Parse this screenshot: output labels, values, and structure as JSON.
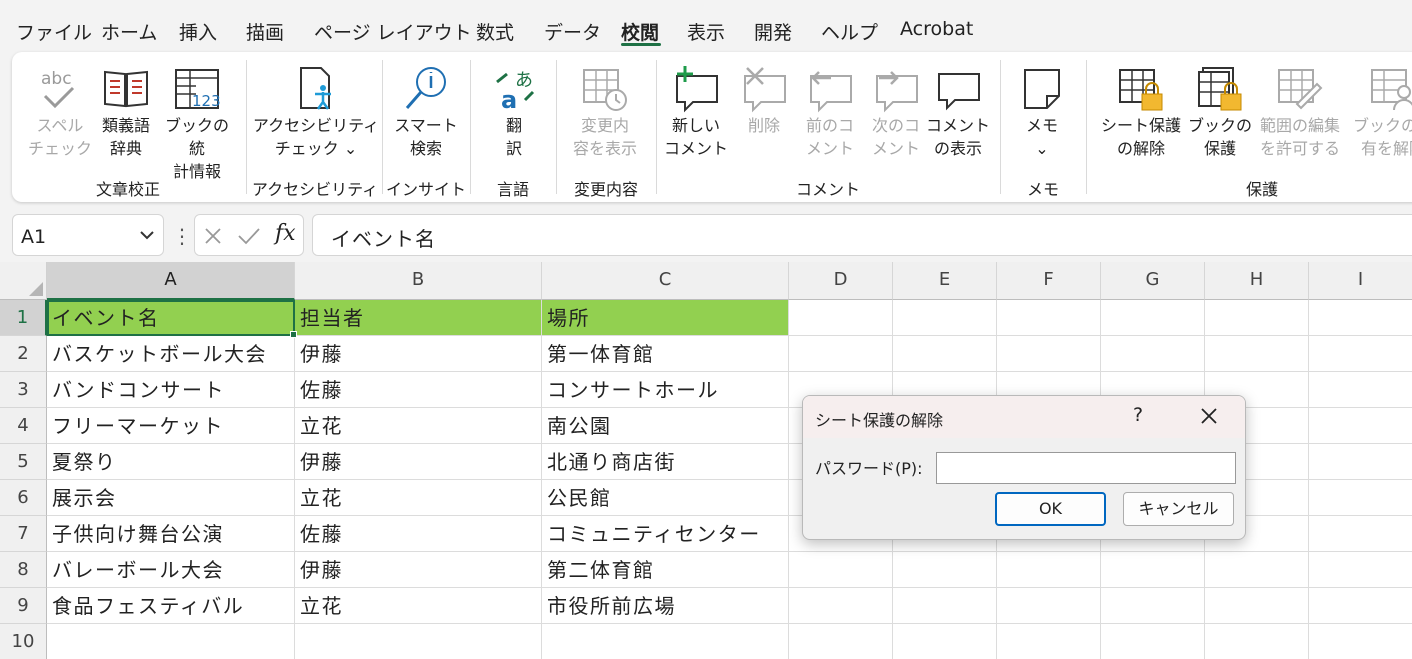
{
  "tabs": [
    {
      "label": "ファイル"
    },
    {
      "label": "ホーム"
    },
    {
      "label": "挿入"
    },
    {
      "label": "描画"
    },
    {
      "label": "ページ レイアウト"
    },
    {
      "label": "数式"
    },
    {
      "label": "データ"
    },
    {
      "label": "校閲"
    },
    {
      "label": "表示"
    },
    {
      "label": "開発"
    },
    {
      "label": "ヘルプ"
    },
    {
      "label": "Acrobat"
    }
  ],
  "active_tab": "校閲",
  "ribbon": {
    "buttons": {
      "spell": "スペル\nチェック",
      "thesaurus": "類義語\n辞典",
      "workbook_stats": "ブックの統\n計情報",
      "accessibility": "アクセシビリティ\nチェック ⌄",
      "smart_lookup": "スマート\n検索",
      "translate": "翻\n訳",
      "show_changes": "変更内\n容を表示",
      "new_comment": "新しい\nコメント",
      "delete": "削除",
      "prev_comment": "前のコ\nメント",
      "next_comment": "次のコ\nメント",
      "show_comments": "コメント\nの表示",
      "notes": "メモ\n⌄",
      "unprotect_sheet": "シート保護\nの解除",
      "protect_workbook": "ブックの\n保護",
      "allow_edit_ranges": "範囲の編集\nを許可する",
      "unshare": "ブックの共\n有を解除"
    },
    "groups": {
      "proofing": "文章校正",
      "accessibility": "アクセシビリティ",
      "insights": "インサイト",
      "language": "言語",
      "changes": "変更内容",
      "comments": "コメント",
      "notes": "メモ",
      "protect": "保護"
    }
  },
  "formula_bar": {
    "name_box": "A1",
    "fx": "fx",
    "content": "イベント名"
  },
  "grid": {
    "columns": [
      "A",
      "B",
      "C",
      "D",
      "E",
      "F",
      "G",
      "H",
      "I"
    ],
    "row_numbers": [
      "1",
      "2",
      "3",
      "4",
      "5",
      "6",
      "7",
      "8",
      "9",
      "10"
    ],
    "rows": [
      [
        "イベント名",
        "担当者",
        "場所"
      ],
      [
        "バスケットボール大会",
        "伊藤",
        "第一体育館"
      ],
      [
        "バンドコンサート",
        "佐藤",
        "コンサートホール"
      ],
      [
        "フリーマーケット",
        "立花",
        "南公園"
      ],
      [
        "夏祭り",
        "伊藤",
        "北通り商店街"
      ],
      [
        "展示会",
        "立花",
        "公民館"
      ],
      [
        "子供向け舞台公演",
        "佐藤",
        "コミュニティセンター"
      ],
      [
        "バレーボール大会",
        "伊藤",
        "第二体育館"
      ],
      [
        "食品フェスティバル",
        "立花",
        "市役所前広場"
      ],
      [
        "",
        "",
        ""
      ]
    ],
    "header_fill": "#92d050",
    "accent": "#1e7145"
  },
  "dialog": {
    "title": "シート保護の解除",
    "help": "?",
    "password_label": "パスワード(P):",
    "password_value": "",
    "ok": "OK",
    "cancel": "キャンセル"
  }
}
